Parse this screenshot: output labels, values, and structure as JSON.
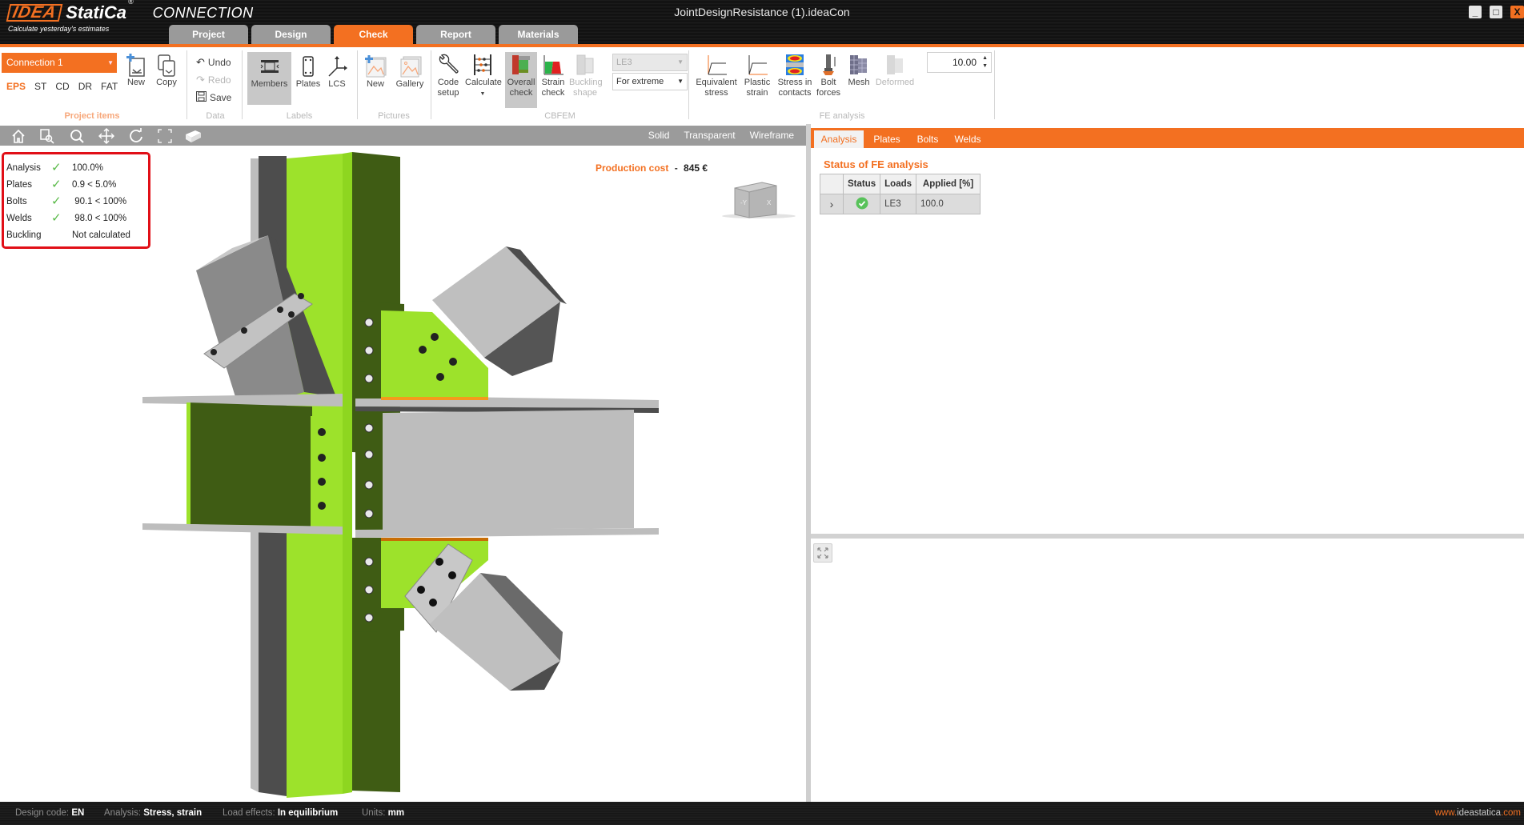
{
  "app": {
    "brand": "IDEA",
    "brand_suffix": "StatiCa",
    "registered": "®",
    "product": "CONNECTION",
    "slogan": "Calculate yesterday's estimates",
    "window_title": "JointDesignResistance (1).ideaCon",
    "window_buttons": {
      "minimize": "_",
      "maximize": "□",
      "close": "X"
    }
  },
  "main_tabs": [
    {
      "label": "Project",
      "active": false
    },
    {
      "label": "Design",
      "active": false
    },
    {
      "label": "Check",
      "active": true
    },
    {
      "label": "Report",
      "active": false
    },
    {
      "label": "Materials",
      "active": false
    }
  ],
  "ribbon": {
    "project_items": {
      "label": "Project items",
      "connection_select": "Connection 1",
      "sub_tabs": [
        {
          "label": "EPS",
          "active": true
        },
        {
          "label": "ST",
          "active": false
        },
        {
          "label": "CD",
          "active": false
        },
        {
          "label": "DR",
          "active": false
        },
        {
          "label": "FAT",
          "active": false
        }
      ],
      "new_label": "New",
      "copy_label": "Copy"
    },
    "data": {
      "label": "Data",
      "undo": "Undo",
      "redo": "Redo",
      "save": "Save"
    },
    "labels": {
      "label": "Labels",
      "members": "Members",
      "plates": "Plates",
      "lcs": "LCS"
    },
    "pictures": {
      "label": "Pictures",
      "new": "New",
      "gallery": "Gallery"
    },
    "cbfem": {
      "label": "CBFEM",
      "code_setup": [
        "Code",
        "setup"
      ],
      "calculate": "Calculate",
      "overall_check": [
        "Overall",
        "check"
      ],
      "strain_check": [
        "Strain",
        "check"
      ],
      "buckling_shape": [
        "Buckling",
        "shape"
      ],
      "load_case": "LE3",
      "extreme_mode": "For extreme"
    },
    "fe_analysis": {
      "label": "FE analysis",
      "equivalent_stress": [
        "Equivalent",
        "stress"
      ],
      "plastic_strain": [
        "Plastic",
        "strain"
      ],
      "stress_in_contacts": [
        "Stress in",
        "contacts"
      ],
      "bolt_forces": [
        "Bolt",
        "forces"
      ],
      "mesh": "Mesh",
      "deformed": "Deformed",
      "scale_value": "10.00"
    }
  },
  "viewport": {
    "toolbar_icons": [
      "home-icon",
      "zoom-window-icon",
      "zoom-icon",
      "pan-icon",
      "rotate-icon",
      "fit-icon",
      "view-cube-icon"
    ],
    "view_modes": [
      "Solid",
      "Transparent",
      "Wireframe"
    ],
    "check_summary": [
      {
        "name": "Analysis",
        "ok": true,
        "value": "100.0%"
      },
      {
        "name": "Plates",
        "ok": true,
        "value": "0.9 < 5.0%"
      },
      {
        "name": "Bolts",
        "ok": true,
        "value": " 90.1 < 100%"
      },
      {
        "name": "Welds",
        "ok": true,
        "value": " 98.0 < 100%"
      },
      {
        "name": "Buckling",
        "ok": null,
        "value": "Not calculated"
      }
    ],
    "production_cost_label": "Production cost",
    "production_cost_sep": "-",
    "production_cost_value": "845 €",
    "navcube_labels": {
      "front": "-Y",
      "side": "X"
    }
  },
  "right_panel": {
    "tabs": [
      {
        "label": "Analysis",
        "active": true
      },
      {
        "label": "Plates",
        "active": false
      },
      {
        "label": "Bolts",
        "active": false
      },
      {
        "label": "Welds",
        "active": false
      }
    ],
    "title": "Status of FE analysis",
    "table": {
      "headers": [
        "",
        "Status",
        "Loads",
        "Applied [%]"
      ],
      "rows": [
        {
          "expand": "›",
          "status": "ok",
          "loads": "LE3",
          "applied": "100.0"
        }
      ]
    }
  },
  "statusbar": {
    "design_code_label": "Design code:",
    "design_code": "EN",
    "analysis_label": "Analysis:",
    "analysis": "Stress, strain",
    "load_effects_label": "Load effects:",
    "load_effects": "In equilibrium",
    "units_label": "Units:",
    "units": "mm",
    "url_prefix": "www.",
    "url_main": "ideastatica",
    "url_suffix": ".com"
  },
  "colors": {
    "accent": "#f37021",
    "check_ok": "#58b947",
    "highlight_border": "#e10f17",
    "member_green": "#9de22b",
    "member_dark_green": "#3f5c14",
    "steel_light": "#bcbcbc",
    "steel_dark": "#4d4d4d"
  }
}
